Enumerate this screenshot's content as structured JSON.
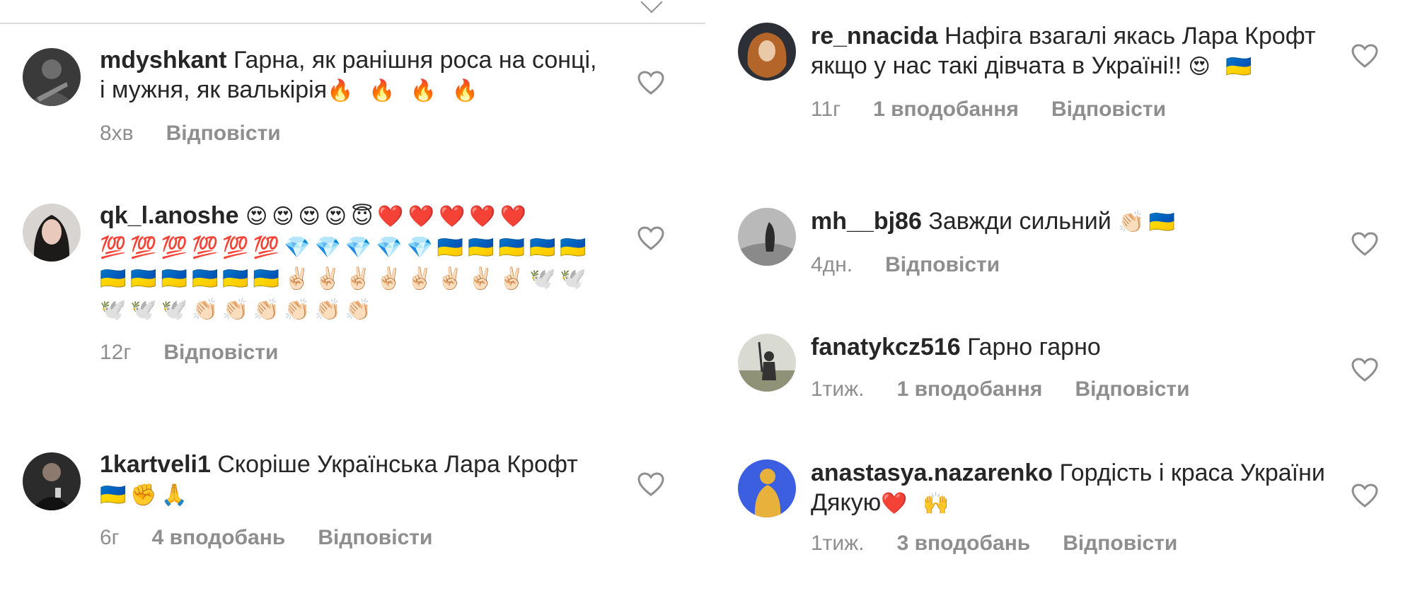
{
  "left_column": {
    "comments": [
      {
        "username": "mdyshkant",
        "text": "Гарна, як ранішня роса на сонці, і мужня, як валькірія",
        "emoji": "🔥 🔥 🔥 🔥",
        "time": "8хв",
        "likes": "",
        "reply_label": "Відповісти"
      },
      {
        "username": "qk_l.anoshe",
        "text": "",
        "emoji": "😍😍😍😍😇❤️❤️❤️❤️❤️💯💯💯💯💯💯💎💎💎💎💎🇺🇦🇺🇦🇺🇦🇺🇦🇺🇦🇺🇦🇺🇦🇺🇦🇺🇦🇺🇦🇺🇦✌🏻✌🏻✌🏻✌🏻✌🏻✌🏻✌🏻✌🏻🕊️🕊️🕊️🕊️🕊️👏🏻👏🏻👏🏻👏🏻👏🏻👏🏻",
        "time": "12г",
        "likes": "",
        "reply_label": "Відповісти"
      },
      {
        "username": "1kartveli1",
        "text": "Скоріше Українська  Лара Крофт",
        "emoji": "🇺🇦✊🙏",
        "time": "6г",
        "likes": "4 вподобань",
        "reply_label": "Відповісти"
      }
    ]
  },
  "right_column": {
    "comments": [
      {
        "username": "re_nnacida",
        "text": "Нафіга взагалі якась Лара Крофт якщо у нас такі дівчата в Україні!!",
        "emoji": "😍 🇺🇦",
        "time": "11г",
        "likes": "1 вподобання",
        "reply_label": "Відповісти"
      },
      {
        "username": "mh__bj86",
        "text": "Завжди сильний",
        "emoji": "👏🏻🇺🇦",
        "time": "4дн.",
        "likes": "",
        "reply_label": "Відповісти"
      },
      {
        "username": "fanatykcz516",
        "text": "Гарно гарно",
        "emoji": "",
        "time": "1тиж.",
        "likes": "1 вподобання",
        "reply_label": "Відповісти"
      },
      {
        "username": "anastasya.nazarenko",
        "text": "Гордість і краса України",
        "text_line2": "Дякую",
        "emoji": "❤️ 🙌",
        "time": "1тиж.",
        "likes": "3 вподобань",
        "reply_label": "Відповісти"
      }
    ]
  },
  "icons": {
    "like": "heart-outline-icon",
    "avatar": "avatar-icon"
  },
  "colors": {
    "text": "#262626",
    "muted": "#8e8e8e",
    "avatar_blue": "#3b5fe0",
    "avatar_gold": "#e8b13c"
  }
}
